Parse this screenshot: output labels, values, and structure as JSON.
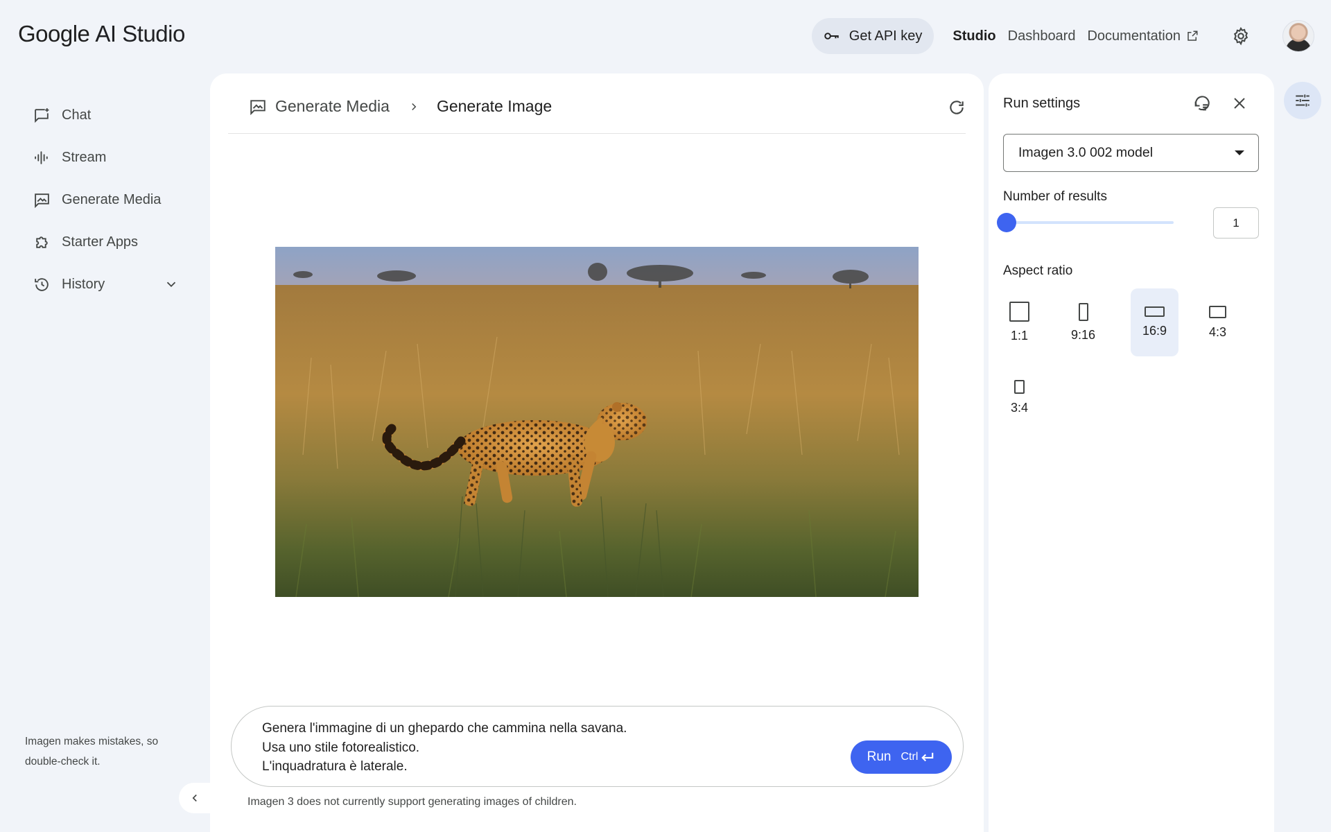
{
  "header": {
    "logo_google": "Google",
    "logo_product": "AI Studio",
    "api_key_label": "Get API key",
    "nav": {
      "studio": "Studio",
      "dashboard": "Dashboard",
      "documentation": "Documentation"
    }
  },
  "sidebar": {
    "items": [
      {
        "label": "Chat",
        "icon": "chat-icon"
      },
      {
        "label": "Stream",
        "icon": "audio-wave-icon"
      },
      {
        "label": "Generate Media",
        "icon": "image-icon"
      },
      {
        "label": "Starter Apps",
        "icon": "puzzle-icon"
      },
      {
        "label": "History",
        "icon": "history-icon"
      }
    ],
    "disclaimer": "Imagen makes mistakes, so double-check it."
  },
  "main": {
    "breadcrumb": {
      "parent": "Generate Media",
      "current": "Generate Image"
    },
    "image_alt": "Leopard walking through savanna grass",
    "prompt_lines": [
      "Genera l'immagine di un ghepardo che cammina nella savana.",
      "Usa uno stile fotorealistico.",
      "L'inquadratura è laterale."
    ],
    "run_label": "Run",
    "run_shortcut": "Ctrl",
    "footnote": "Imagen 3 does not currently support generating images of children."
  },
  "settings": {
    "title": "Run settings",
    "model": "Imagen 3.0 002 model",
    "num_results_label": "Number of results",
    "num_results_value": "1",
    "aspect_label": "Aspect ratio",
    "aspect_options": [
      "1:1",
      "9:16",
      "16:9",
      "4:3",
      "3:4"
    ],
    "aspect_selected": "16:9"
  },
  "colors": {
    "accent": "#3e64f0",
    "background": "#f1f4f9",
    "panel": "#ffffff"
  }
}
